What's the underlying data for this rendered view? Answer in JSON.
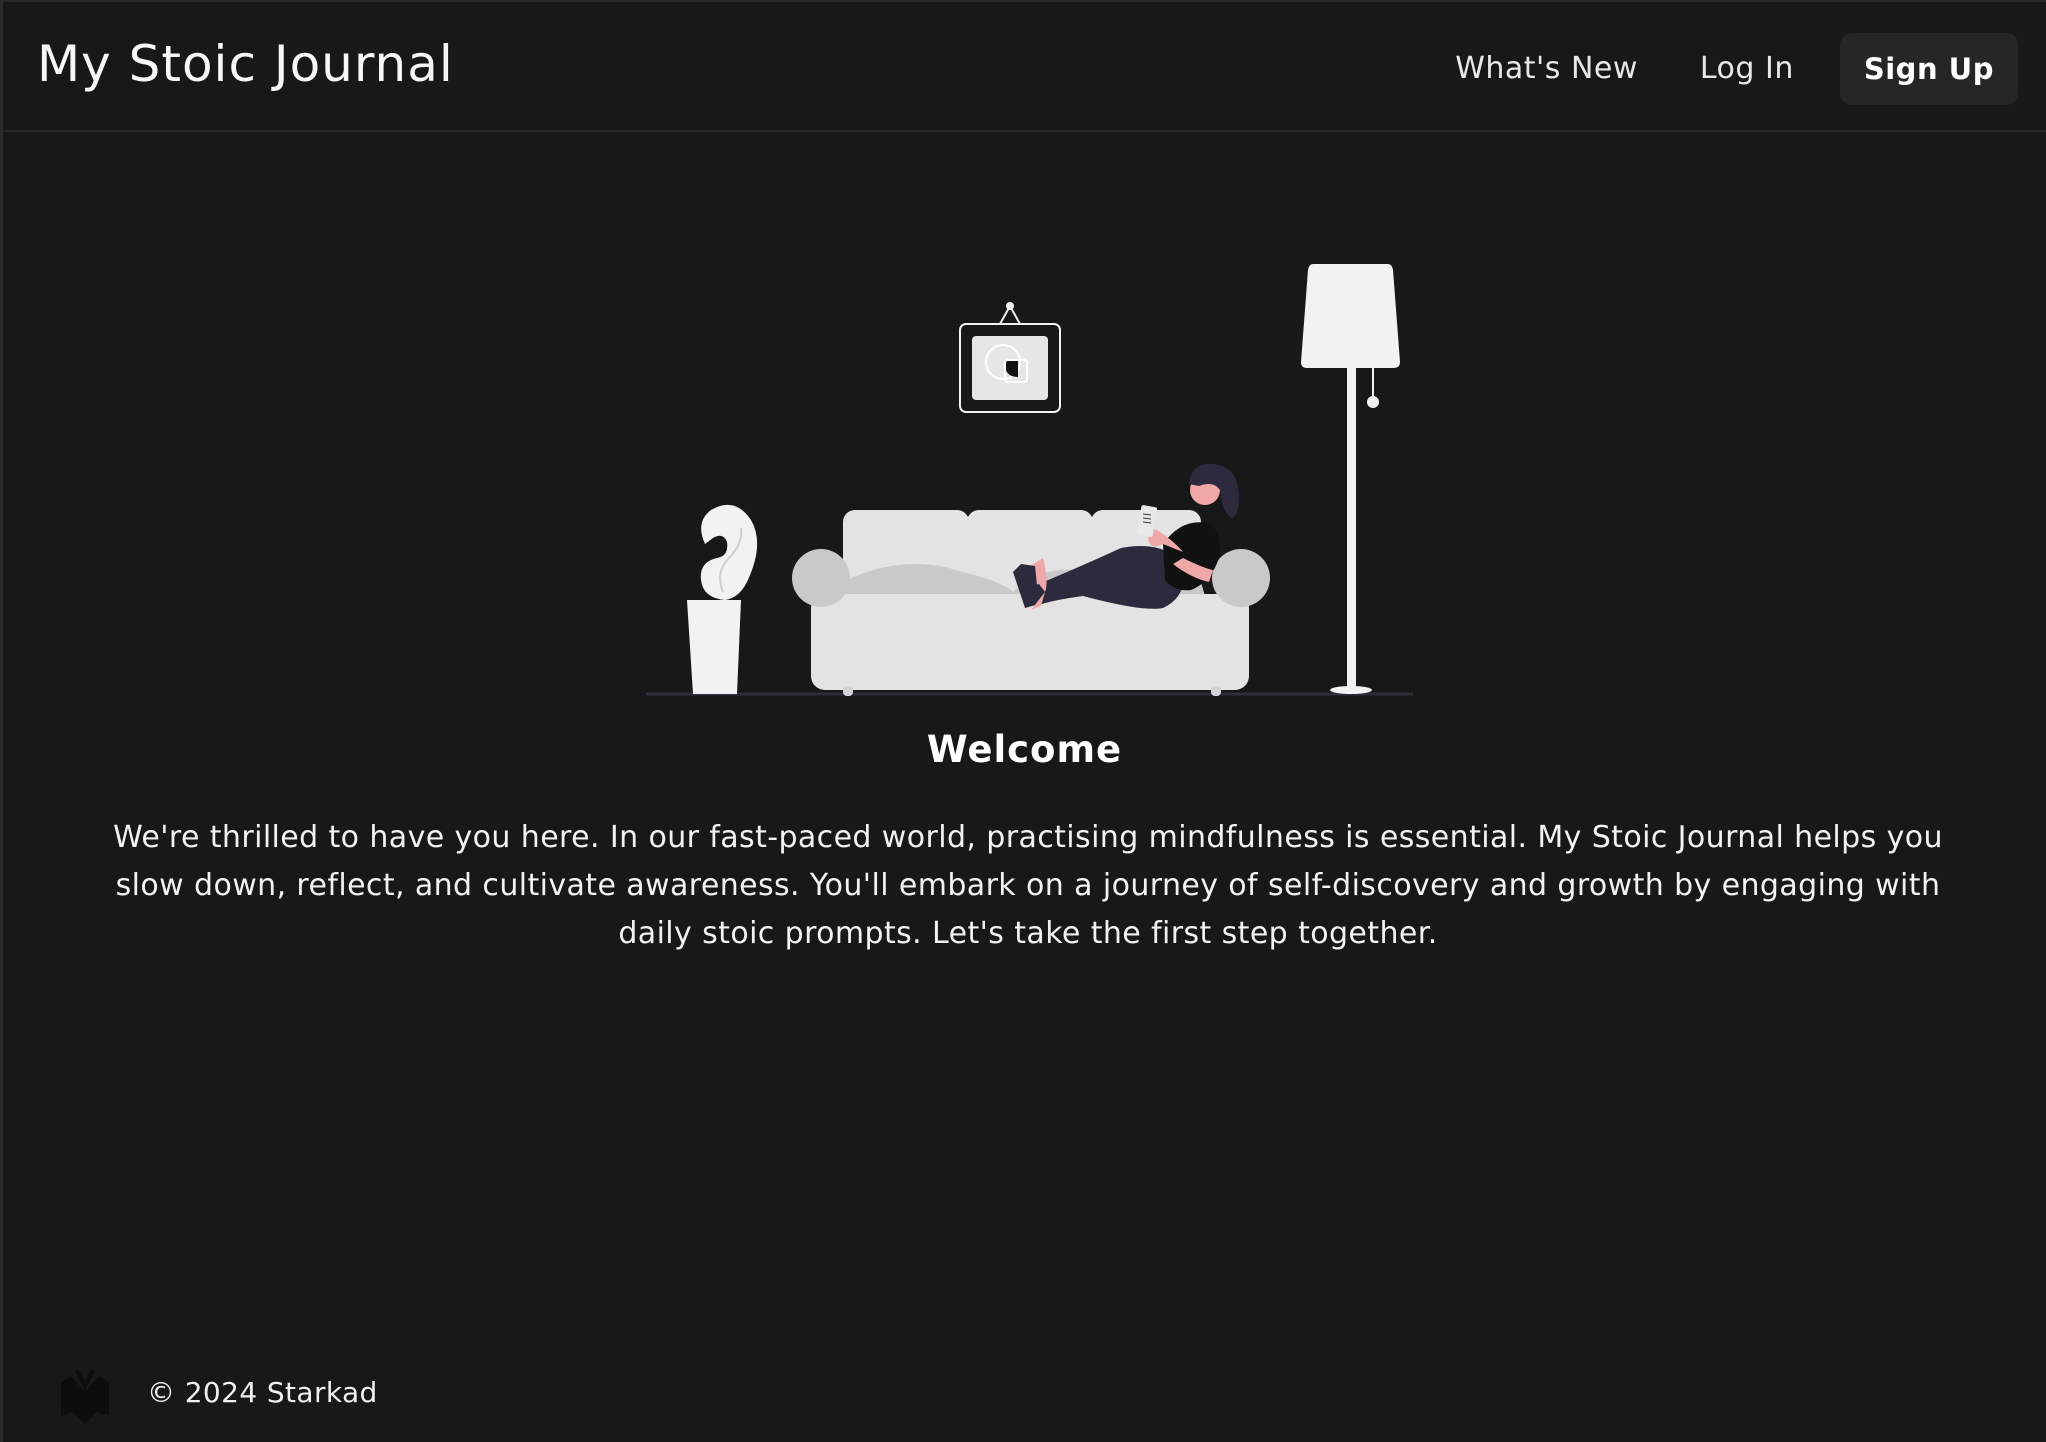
{
  "header": {
    "brand": "My Stoic Journal",
    "nav": {
      "whats_new": "What's New",
      "log_in": "Log In",
      "sign_up": "Sign Up"
    }
  },
  "main": {
    "illustration_icon": "woman-reading-on-sofa-illustration",
    "title": "Welcome",
    "intro": "We're thrilled to have you here. In our fast-paced world, practising mindfulness is essential. My Stoic Journal helps you slow down, reflect, and cultivate awareness. You'll embark on a journey of self-discovery and growth by engaging with daily stoic prompts. Let's take the first step together."
  },
  "footer": {
    "logo_icon": "book-logo-icon",
    "copyright": "© 2024 Starkad"
  },
  "colors": {
    "background": "#181818",
    "button_bg": "#262626",
    "text": "#f5f5f5"
  }
}
